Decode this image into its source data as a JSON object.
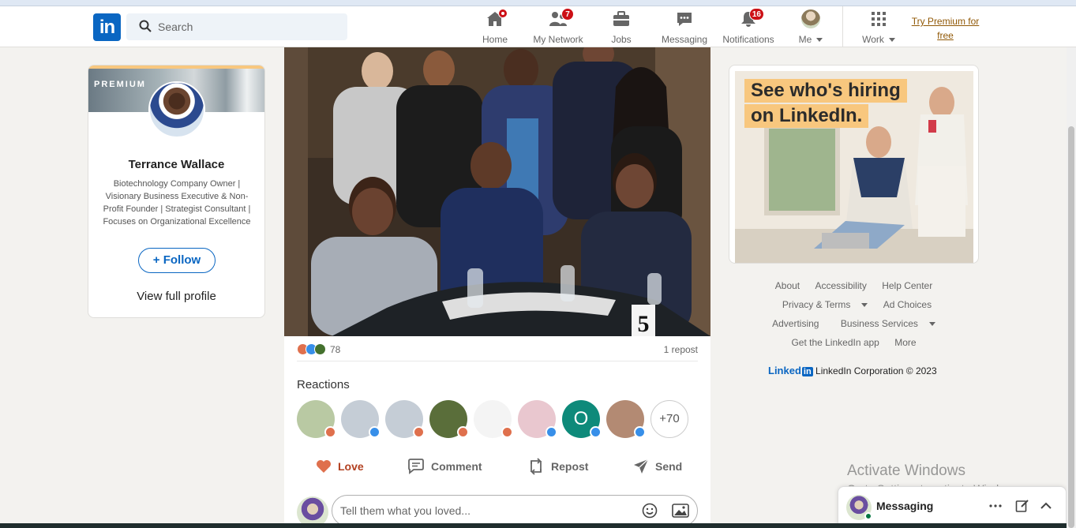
{
  "nav": {
    "search_placeholder": "Search",
    "items": [
      {
        "label": "Home",
        "icon": "home-icon",
        "badge": ""
      },
      {
        "label": "My Network",
        "icon": "network-icon",
        "badge": "7"
      },
      {
        "label": "Jobs",
        "icon": "briefcase-icon",
        "badge": ""
      },
      {
        "label": "Messaging",
        "icon": "chat-icon",
        "badge": ""
      },
      {
        "label": "Notifications",
        "icon": "bell-icon",
        "badge": "16"
      },
      {
        "label": "Me",
        "icon": "avatar",
        "badge": ""
      },
      {
        "label": "Work",
        "icon": "grid-icon",
        "badge": ""
      }
    ],
    "premium_link": "Try Premium for free"
  },
  "profile": {
    "premium_label": "PREMIUM",
    "name": "Terrance Wallace",
    "headline": "Biotechnology Company Owner | Visionary Business Executive & Non-Profit Founder | Strategist Consultant | Focuses on Organizational Excellence",
    "follow_label": "Follow",
    "view_profile_label": "View full profile"
  },
  "post": {
    "reaction_count": "78",
    "repost_count": "1 repost",
    "reactions_title": "Reactions",
    "reactors": [
      {
        "reaction": "love",
        "color": "#b9c9a3"
      },
      {
        "reaction": "like",
        "color": "#c5cdd6"
      },
      {
        "reaction": "love",
        "color": "#c5cdd6"
      },
      {
        "reaction": "love",
        "color": "#5a6e3a"
      },
      {
        "reaction": "love",
        "color": "#f4f4f4"
      },
      {
        "reaction": "like",
        "color": "#e9c7cf"
      },
      {
        "reaction": "like",
        "color": "#0e8a7a",
        "initial": "O"
      },
      {
        "reaction": "like",
        "color": "#b38a73"
      }
    ],
    "more_reactors": "+70",
    "actions": {
      "love": "Love",
      "comment": "Comment",
      "repost": "Repost",
      "send": "Send"
    },
    "comment_placeholder": "Tell them what you loved..."
  },
  "ad": {
    "line1": "See who's hiring",
    "line2": "on LinkedIn."
  },
  "footer": {
    "row1": [
      "About",
      "Accessibility",
      "Help Center"
    ],
    "row2": [
      "Privacy & Terms",
      "Ad Choices"
    ],
    "row3": [
      "Advertising",
      "Business Services"
    ],
    "row4": [
      "Get the LinkedIn app",
      "More"
    ],
    "brand": "Linked",
    "brand_in": "in",
    "copyright": "LinkedIn Corporation © 2023"
  },
  "watermark": {
    "line1": "Activate Windows",
    "line2": "Go to Settings to activate Windows."
  },
  "messaging": {
    "title": "Messaging"
  },
  "colors": {
    "brand_blue": "#0a66c2",
    "premium_gold": "#f8c77e",
    "notification_red": "#cc1016",
    "love_red": "#b24020"
  }
}
